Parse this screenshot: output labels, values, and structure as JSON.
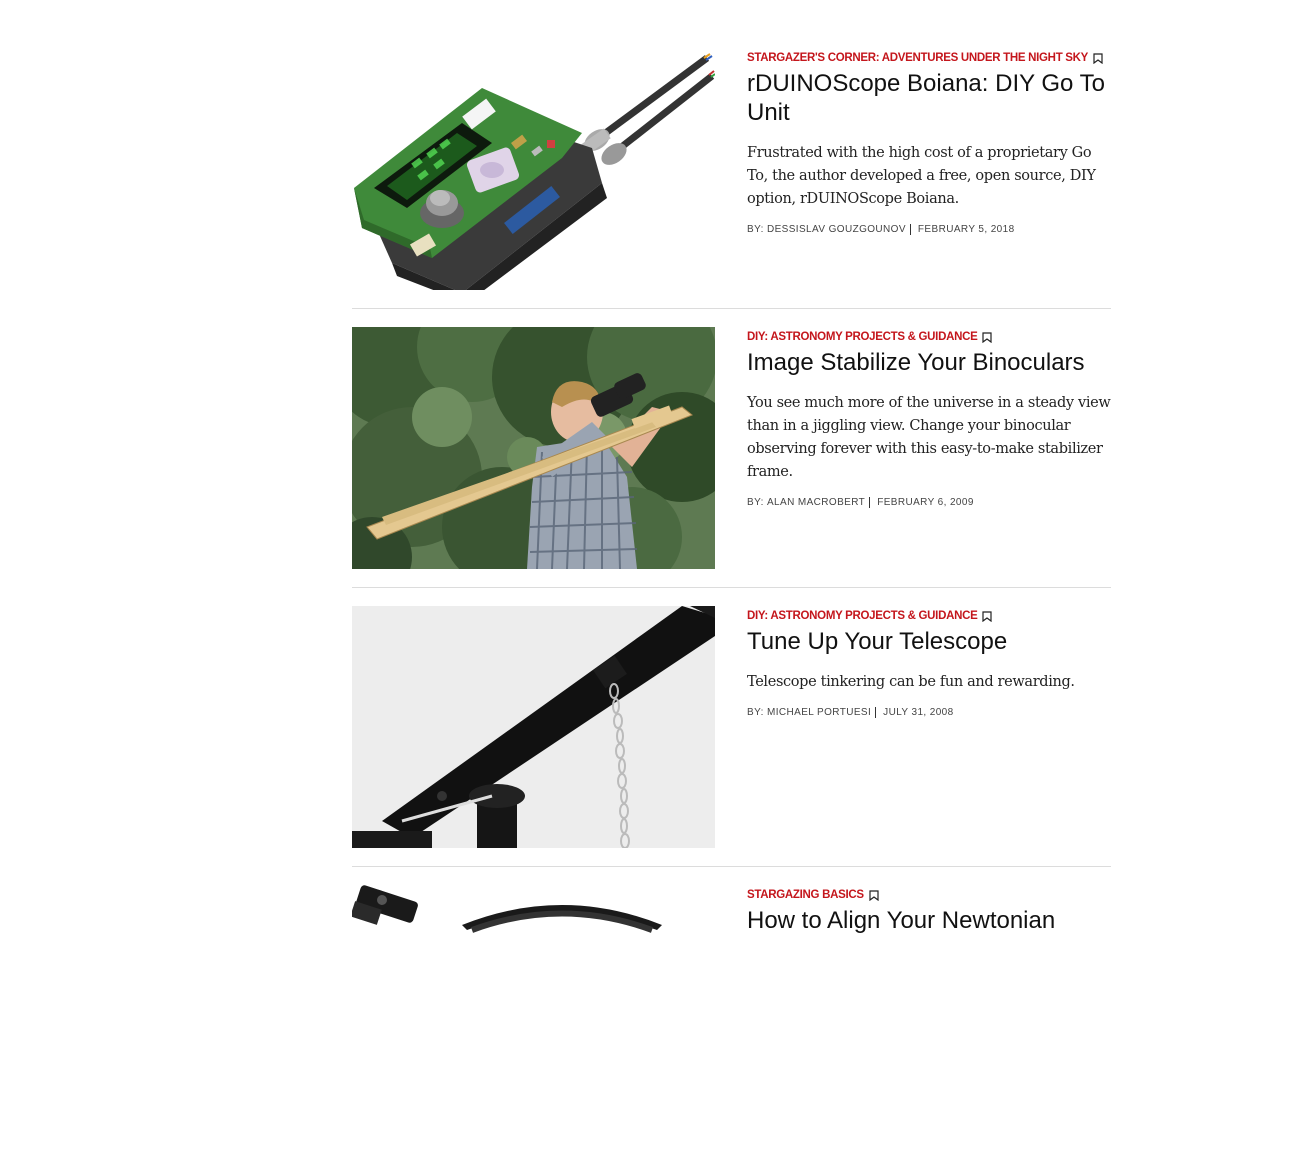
{
  "articles": [
    {
      "category": "STARGAZER'S CORNER: ADVENTURES UNDER THE NIGHT SKY",
      "title": "rDUINOScope Boiana: DIY Go To Unit",
      "summary": "Frustrated with the high cost of a proprietary Go To, the author developed a free, open source, DIY option, rDUINOScope Boiana.",
      "by_label": "BY:",
      "author": "DESSISLAV GOUZGOUNOV",
      "date": "FEBRUARY 5, 2018",
      "image": "circuit-board-photo"
    },
    {
      "category": "DIY: ASTRONOMY PROJECTS & GUIDANCE",
      "title": "Image Stabilize Your Binoculars",
      "summary": "You see much more of the universe in a steady view than in a jiggling view. Change your binocular observing forever with this easy-to-make stabilizer frame.",
      "by_label": "BY:",
      "author": "ALAN MACROBERT",
      "date": "FEBRUARY 6, 2009",
      "image": "binocular-stabilizer-photo"
    },
    {
      "category": "DIY: ASTRONOMY PROJECTS & GUIDANCE",
      "title": "Tune Up Your Telescope",
      "summary": "Telescope tinkering can be fun and rewarding.",
      "by_label": "BY:",
      "author": "MICHAEL PORTUESI",
      "date": "JULY 31, 2008",
      "image": "telescope-photo"
    },
    {
      "category": "STARGAZING BASICS",
      "title": "How to Align Your Newtonian",
      "summary": "",
      "by_label": "",
      "author": "",
      "date": "",
      "image": "newtonian-photo"
    }
  ],
  "colors": {
    "category": "#c4161c",
    "headline": "#111111",
    "divider": "#dcdcdc"
  }
}
